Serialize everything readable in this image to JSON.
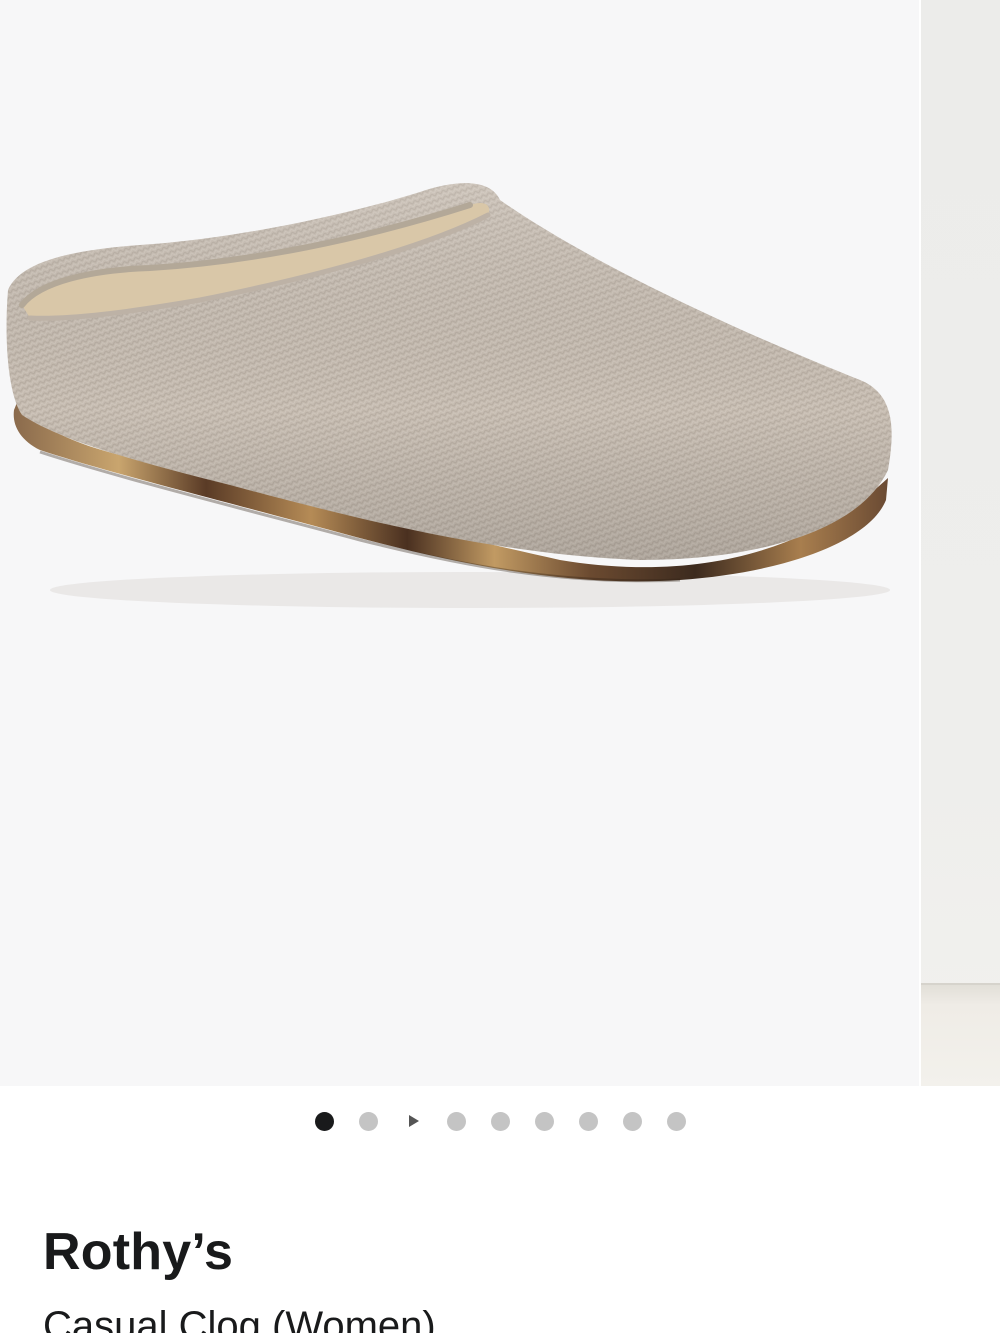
{
  "product": {
    "brand": "Rothy’s",
    "name": "Casual Clog (Women)"
  },
  "gallery": {
    "image_label": "beige knit clog with tortoiseshell sole",
    "slide_count": 9,
    "active_index": 0,
    "video_indicator_index": 2
  },
  "colors": {
    "background": "#f7f7f8",
    "dot_active": "#191a1b",
    "dot_inactive": "#c4c4c4",
    "text": "#191a1b"
  }
}
